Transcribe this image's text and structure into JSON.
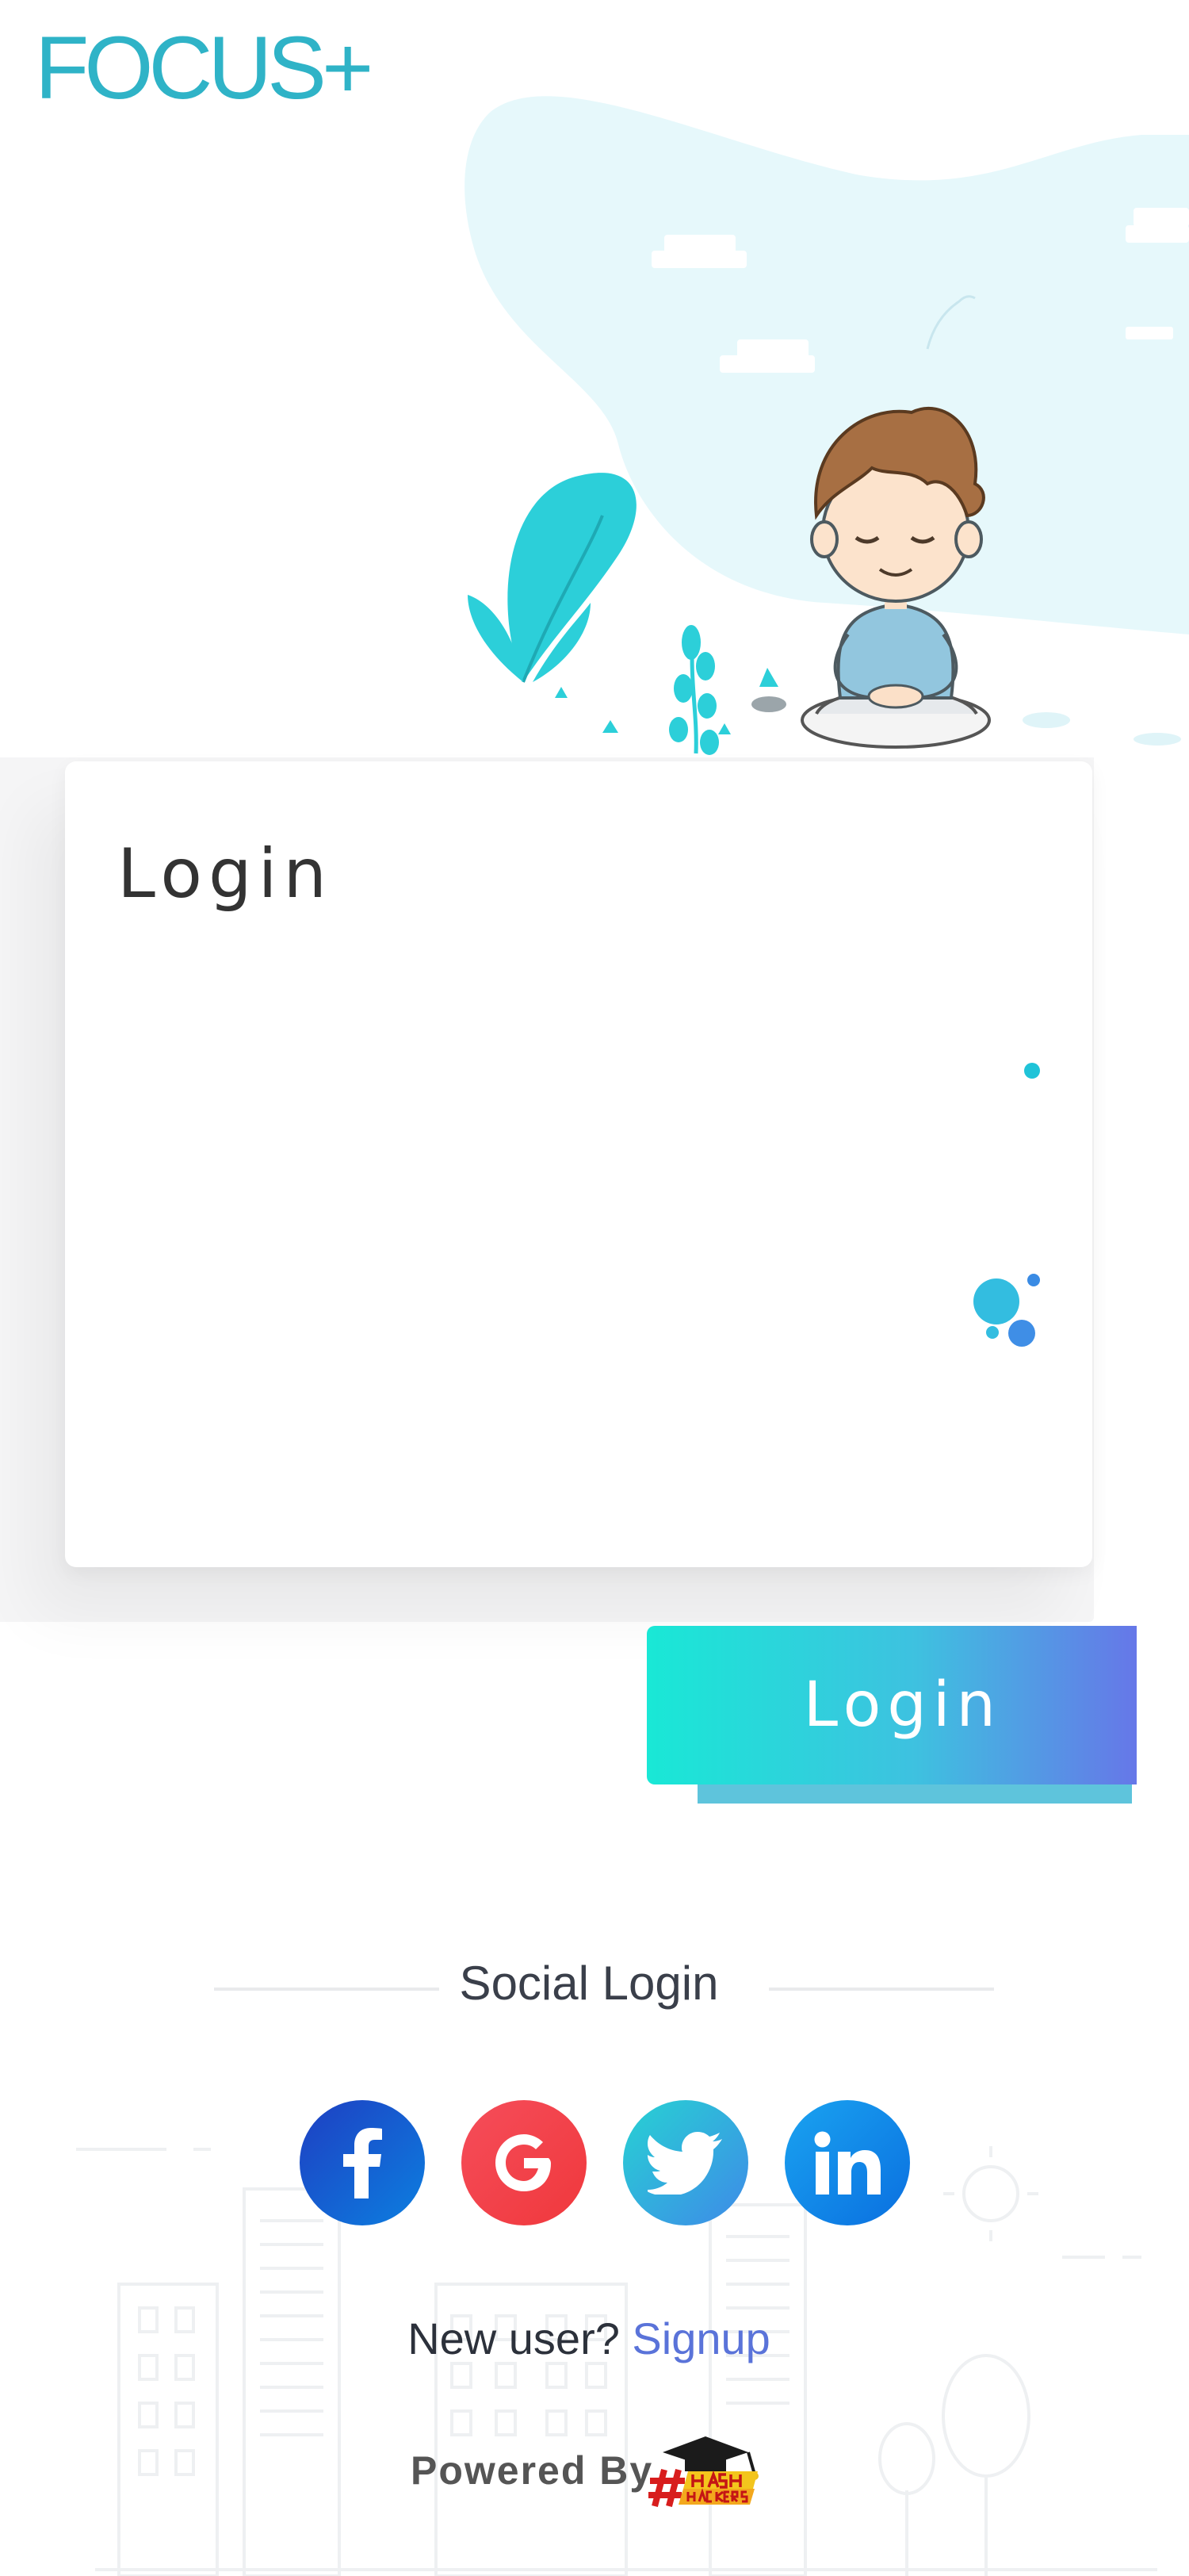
{
  "app": {
    "logo_text": "FOCUS+"
  },
  "login_card": {
    "title": "Login"
  },
  "login_button": {
    "label": "Login"
  },
  "social": {
    "title": "Social Login",
    "buttons": [
      {
        "name": "facebook",
        "icon": "facebook-icon",
        "color_from": "#1e3fc2",
        "color_to": "#0c7fe0"
      },
      {
        "name": "google",
        "icon": "google-icon",
        "color_from": "#f54d5a",
        "color_to": "#f0383c"
      },
      {
        "name": "twitter",
        "icon": "twitter-icon",
        "color_from": "#27d2d3",
        "color_to": "#3e8ae8"
      },
      {
        "name": "linkedin",
        "icon": "linkedin-icon",
        "color_from": "#1aa3f0",
        "color_to": "#0a6fe0"
      }
    ]
  },
  "footer": {
    "new_user_text": "New user?",
    "signup_link": "Signup",
    "powered_by": "Powered By",
    "brand_logo": "hash-hackers-logo"
  },
  "colors": {
    "accent": "#2fb3c7",
    "link": "#5a73d9",
    "blob": "#e6f8fb"
  }
}
